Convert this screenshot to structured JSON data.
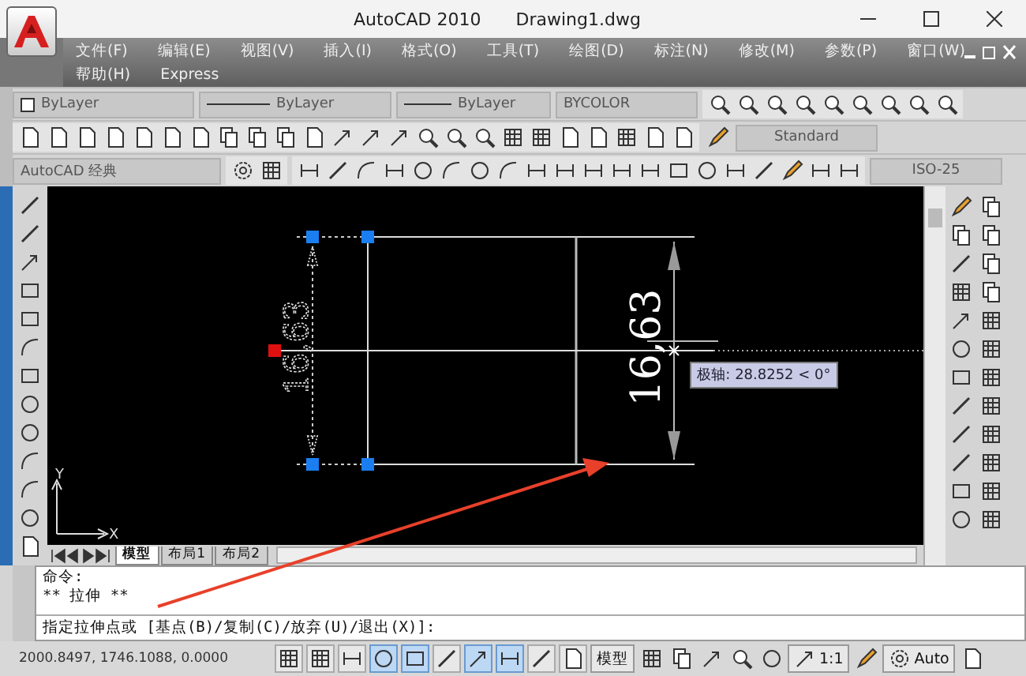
{
  "window": {
    "title": "AutoCAD 2010",
    "document": "Drawing1.dwg"
  },
  "menu": [
    [
      "文件(F)",
      "编辑(E)",
      "视图(V)",
      "插入(I)",
      "格式(O)",
      "工具(T)",
      "绘图(D)",
      "标注(N)",
      "修改(M)",
      "参数(P)",
      "窗口(W)"
    ],
    [
      "帮助(H)",
      "Express"
    ]
  ],
  "properties_toolbar": {
    "layer_color": "ByLayer",
    "linetype": "ByLayer",
    "lineweight": "ByLayer",
    "plot_style": "BYCOLOR"
  },
  "styles_toolbar": {
    "text_style": "Standard"
  },
  "workspace_toolbar": {
    "workspace": "AutoCAD 经典",
    "dim_style": "ISO-25"
  },
  "drawing": {
    "dimension_ghost": "16,63",
    "dimension": "16,63",
    "tooltip": "极轴: 28.8252 < 0°",
    "axis_x": "X",
    "axis_y": "Y"
  },
  "layout_tabs": [
    {
      "label": "模型",
      "selected": true
    },
    {
      "label": "布局1",
      "selected": false
    },
    {
      "label": "布局2",
      "selected": false
    }
  ],
  "command_history": [
    "命令:",
    "** 拉伸 **"
  ],
  "command_prompt": "指定拉伸点或 [基点(B)/复制(C)/放弃(U)/退出(X)]:",
  "status_bar": {
    "coordinates": "2000.8497, 1746.1088, 0.0000",
    "toggles": [
      {
        "on": false
      },
      {
        "on": false
      },
      {
        "on": false
      },
      {
        "on": true
      },
      {
        "on": true
      },
      {
        "on": false
      },
      {
        "on": true
      },
      {
        "on": true
      },
      {
        "on": false
      },
      {
        "on": false
      }
    ],
    "space": "模型",
    "scale": "1:1",
    "workspace": "Auto"
  }
}
